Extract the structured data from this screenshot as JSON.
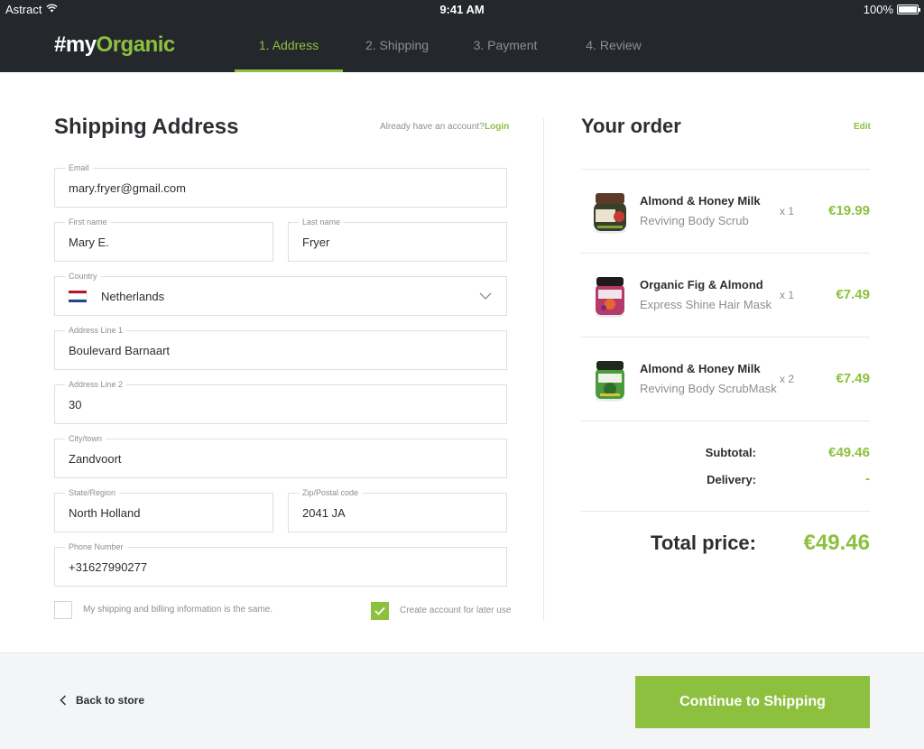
{
  "status_bar": {
    "carrier": "Astract",
    "time": "9:41 AM",
    "battery": "100%"
  },
  "header": {
    "logo_prefix": "#my",
    "logo_brand": "Organic",
    "steps": [
      {
        "label": "1. Address",
        "active": true
      },
      {
        "label": "2. Shipping",
        "active": false
      },
      {
        "label": "3. Payment",
        "active": false
      },
      {
        "label": "4. Review",
        "active": false
      }
    ]
  },
  "form": {
    "title": "Shipping Address",
    "account_prompt": "Already have an account?",
    "login_label": "Login",
    "email": {
      "label": "Email",
      "value": "mary.fryer@gmail.com"
    },
    "first_name": {
      "label": "First name",
      "value": "Mary E."
    },
    "last_name": {
      "label": "Last name",
      "value": "Fryer"
    },
    "country": {
      "label": "Country",
      "value": "Netherlands",
      "flag_colors": [
        "#ae1c28",
        "#ffffff",
        "#21468b"
      ]
    },
    "address1": {
      "label": "Address Line 1",
      "value": "Boulevard Barnaart"
    },
    "address2": {
      "label": "Address Line 2",
      "value": "30"
    },
    "city": {
      "label": "City/town",
      "value": "Zandvoort"
    },
    "state": {
      "label": "State/Region",
      "value": "North Holland"
    },
    "zip": {
      "label": "Zip/Postal code",
      "value": "2041 JA"
    },
    "phone": {
      "label": "Phone Number",
      "value": "+31627990277"
    },
    "same_billing": {
      "label": "My shipping and billing information is the same.",
      "checked": false
    },
    "create_account": {
      "label": "Create account for later use",
      "checked": true
    }
  },
  "order": {
    "title": "Your order",
    "edit_label": "Edit",
    "items": [
      {
        "name": "Almond & Honey Milk",
        "subtitle": "Reviving Body Scrub",
        "qty": "x 1",
        "price": "€19.99",
        "image": "scrub-jar-icon"
      },
      {
        "name": "Organic Fig & Almond",
        "subtitle": "Express Shine Hair Mask",
        "qty": "x 1",
        "price": "€7.49",
        "image": "hair-mask-jar-icon"
      },
      {
        "name": "Almond & Honey Milk",
        "subtitle": "Reviving Body ScrubMask",
        "qty": "x 2",
        "price": "€7.49",
        "image": "body-mask-jar-icon"
      }
    ],
    "subtotal_label": "Subtotal:",
    "subtotal_value": "€49.46",
    "delivery_label": "Delivery:",
    "delivery_value": "-",
    "total_label": "Total price:",
    "total_value": "€49.46"
  },
  "footer": {
    "back_label": "Back to store",
    "continue_label": "Continue to Shipping"
  },
  "colors": {
    "accent": "#8dc03f",
    "header_bg": "#24282c",
    "text": "#2b2f33",
    "muted": "#8a8f94"
  }
}
